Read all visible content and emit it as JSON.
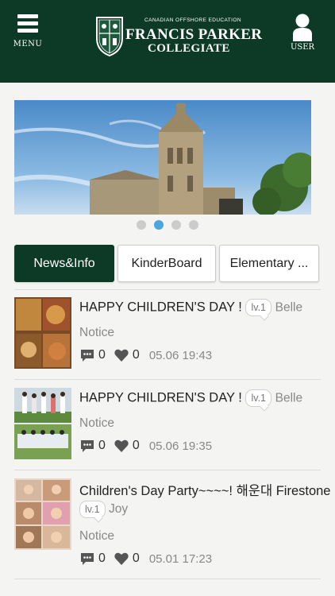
{
  "header": {
    "menu_label": "MENU",
    "school_tagline": "CANADIAN OFFSHORE EDUCATION",
    "school_name": "FRANCIS PARKER",
    "school_sub": "COLLEGIATE",
    "user_label": "USER",
    "brand_color": "#0d3a26"
  },
  "carousel": {
    "slide_count": 4,
    "active_index": 1
  },
  "tabs": [
    {
      "label": "News&Info",
      "active": true
    },
    {
      "label": "KinderBoard",
      "active": false
    },
    {
      "label": "Elementary ...",
      "active": false
    }
  ],
  "posts": [
    {
      "title": "HAPPY CHILDREN'S DAY !",
      "level": "lv.1",
      "author": "Belle",
      "category": "Notice",
      "comments": "0",
      "likes": "0",
      "date": "05.06 19:43"
    },
    {
      "title": "HAPPY CHILDREN'S DAY !",
      "level": "lv.1",
      "author": "Belle",
      "category": "Notice",
      "comments": "0",
      "likes": "0",
      "date": "05.06 19:35"
    },
    {
      "title": "Children's Day Party~~~~! 해운대 Firestone",
      "level": "lv.1",
      "author": "Joy",
      "category": "Notice",
      "comments": "0",
      "likes": "0",
      "date": "05.01 17:23"
    }
  ]
}
